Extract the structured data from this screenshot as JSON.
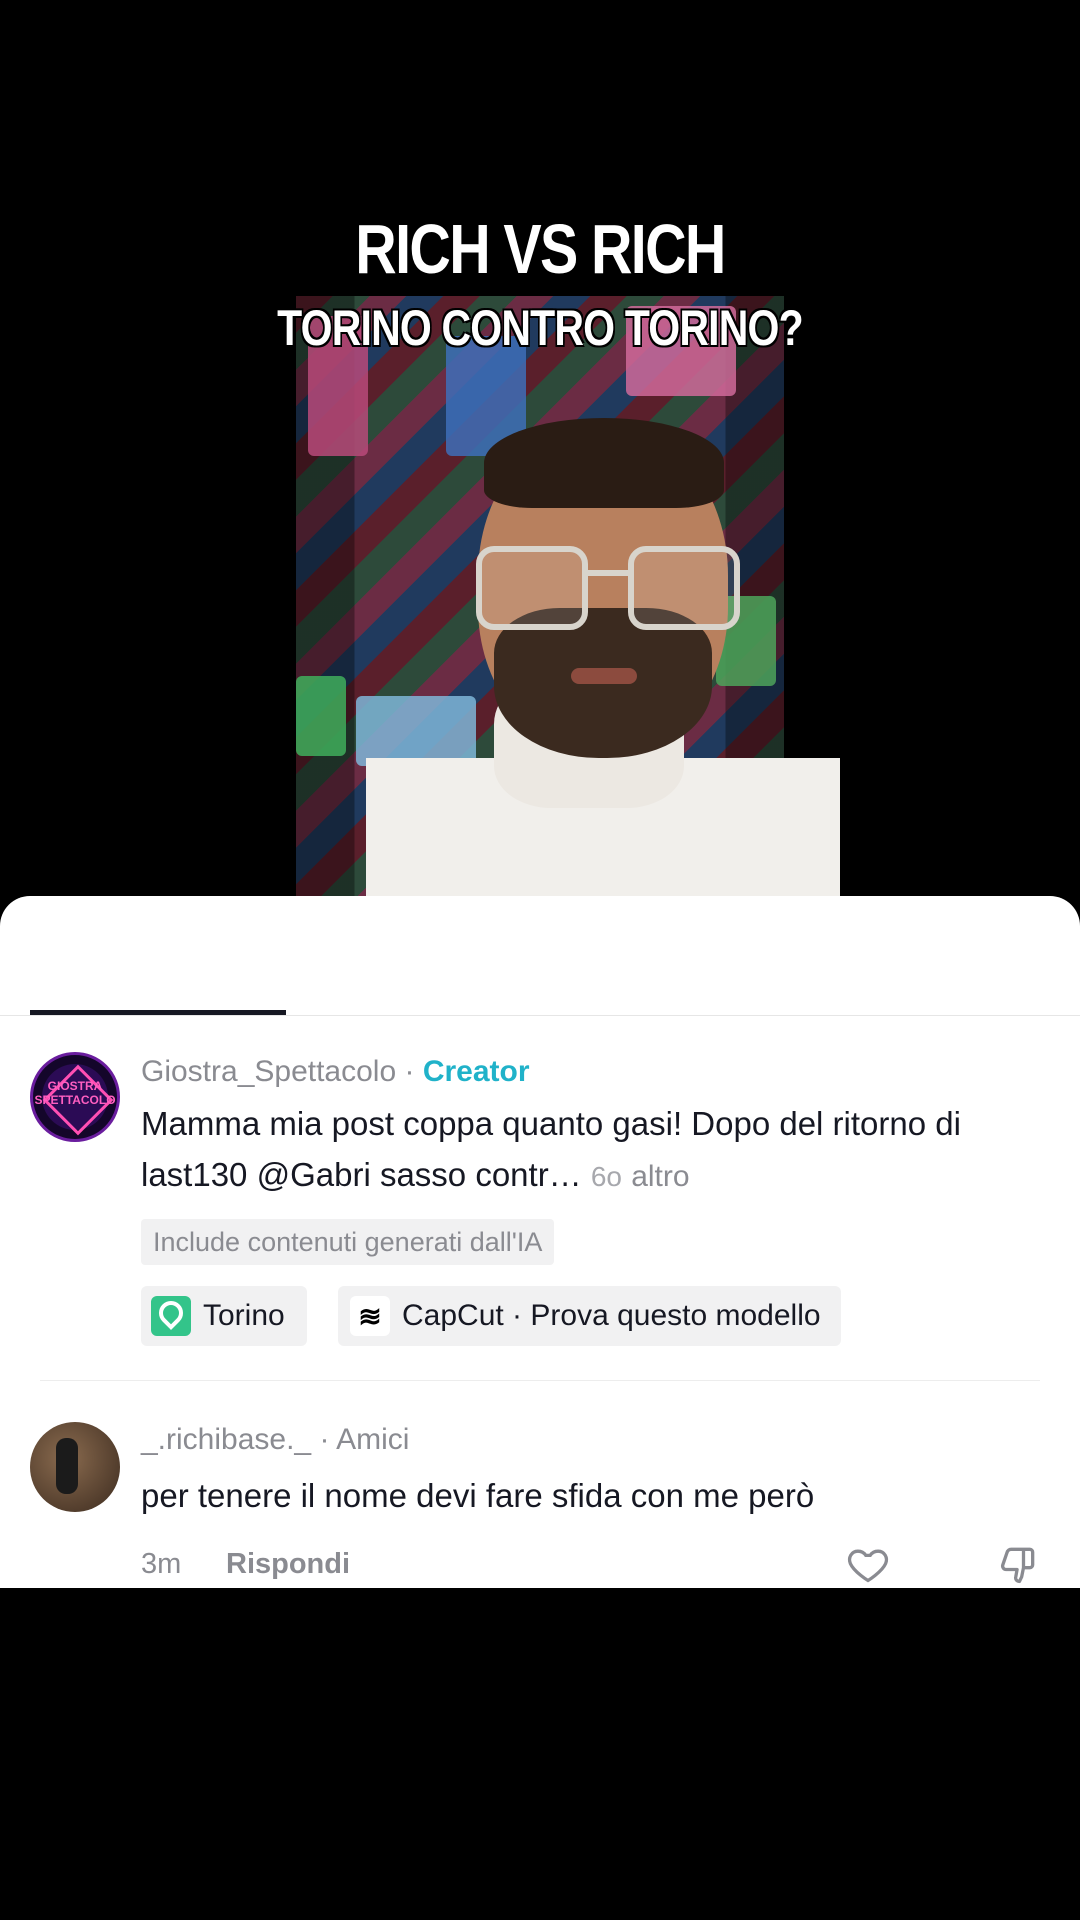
{
  "video": {
    "title_line1": "RICH VS RICH",
    "title_line2": "TORINO CONTRO TORINO?"
  },
  "comments": [
    {
      "author": "Giostra_Spettacolo",
      "role": "Creator",
      "avatar_text": "GIOSTRA SPETTACOLO",
      "text": "Mamma mia post coppa quanto gasi! Dopo del ritorno di last130 @Gabri sasso contr…",
      "time": "6o",
      "more": "altro",
      "ai_label": "Include contenuti generati dall'IA",
      "chips": [
        {
          "icon": "location-pin-icon",
          "label": "Torino"
        },
        {
          "icon": "capcut-icon",
          "label": "CapCut · Prova questo modello"
        }
      ]
    },
    {
      "author": "_.richibase._",
      "role": "Amici",
      "text": "per tenere il nome devi fare sfida con me però",
      "time": "3m",
      "reply": "Rispondi"
    }
  ],
  "colors": {
    "creator_tag": "#20b2c9",
    "location_icon": "#33c48a",
    "text": "#161823",
    "muted": "#8a8b91"
  }
}
